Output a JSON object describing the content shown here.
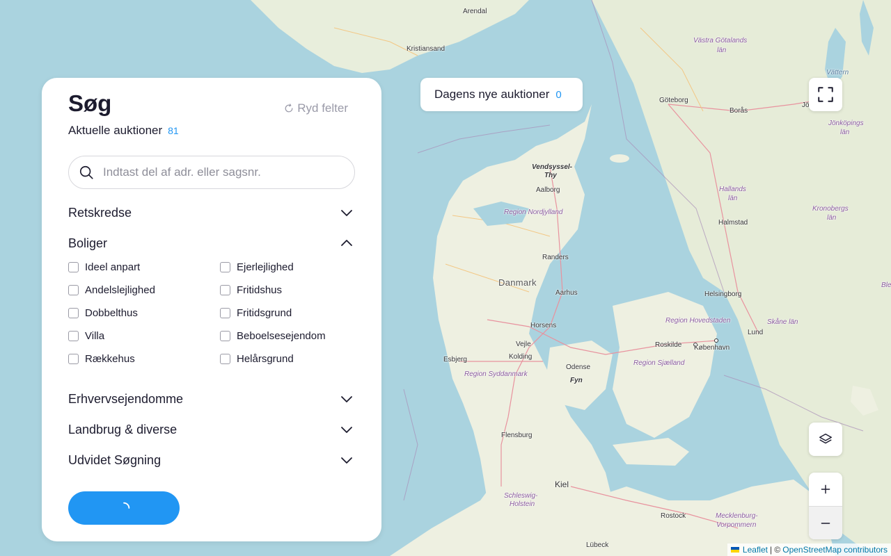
{
  "panel": {
    "title": "Søg",
    "clear_label": "Ryd felter",
    "current_label": "Aktuelle auktioner",
    "current_count": "81",
    "search_placeholder": "Indtast del af adr. eller sagsnr.",
    "sections": {
      "retskredse": "Retskredse",
      "boliger": "Boliger",
      "erhverv": "Erhvervsejendomme",
      "landbrug": "Landbrug & diverse",
      "udvidet": "Udvidet Søgning"
    },
    "boliger_options": [
      "Ideel anpart",
      "Ejerlejlighed",
      "Andelslejlighed",
      "Fritidshus",
      "Dobbelthus",
      "Fritidsgrund",
      "Villa",
      "Beboelsesejendom",
      "Rækkehus",
      "Helårsgrund"
    ]
  },
  "today": {
    "label": "Dagens nye auktioner",
    "count": "0"
  },
  "map": {
    "places": {
      "arendal": "Arendal",
      "kristiansand": "Kristiansand",
      "goteborg": "Göteborg",
      "boras": "Borås",
      "jon": "Jön",
      "vastra": "Västra Götalands",
      "vastra2": "län",
      "jonkoping": "Jönköpings",
      "jonkoping2": "län",
      "vattern": "Vättern",
      "hallands": "Hallands",
      "hallands2": "län",
      "kronobergs": "Kronobergs",
      "kronobergs2": "län",
      "halmstad": "Halmstad",
      "ble": "Ble",
      "vendsyssel": "Vendsyssel-",
      "thy": "Thy",
      "aalborg": "Aalborg",
      "nordjylland": "Region Nordjylland",
      "randers": "Randers",
      "danmark": "Danmark",
      "aarhus": "Aarhus",
      "helsingborg": "Helsingborg",
      "hovedstaden": "Region Hovedstaden",
      "skane": "Skåne län",
      "horsens": "Horsens",
      "vejle": "Vejle",
      "roskilde": "Roskilde",
      "kobenhavn": "København",
      "lund": "Lund",
      "esbjerg": "Esbjerg",
      "kolding": "Kolding",
      "odense": "Odense",
      "sjaelland": "Region Sjælland",
      "syddanmark": "Region Syddanmark",
      "fyn": "Fyn",
      "flensburg": "Flensburg",
      "kiel": "Kiel",
      "schleswig": "Schleswig-",
      "holstein": "Holstein",
      "rostock": "Rostock",
      "mecklenburg": "Mecklenburg-",
      "vorpommern": "Vorpommern",
      "lubeck": "Lübeck"
    },
    "attribution": {
      "leaflet": "Leaflet",
      "sep": "| ©",
      "osm": "OpenStreetMap contributors"
    }
  },
  "colors": {
    "accent": "#2196f3",
    "water": "#aad3df",
    "land": "#f2efe9"
  }
}
